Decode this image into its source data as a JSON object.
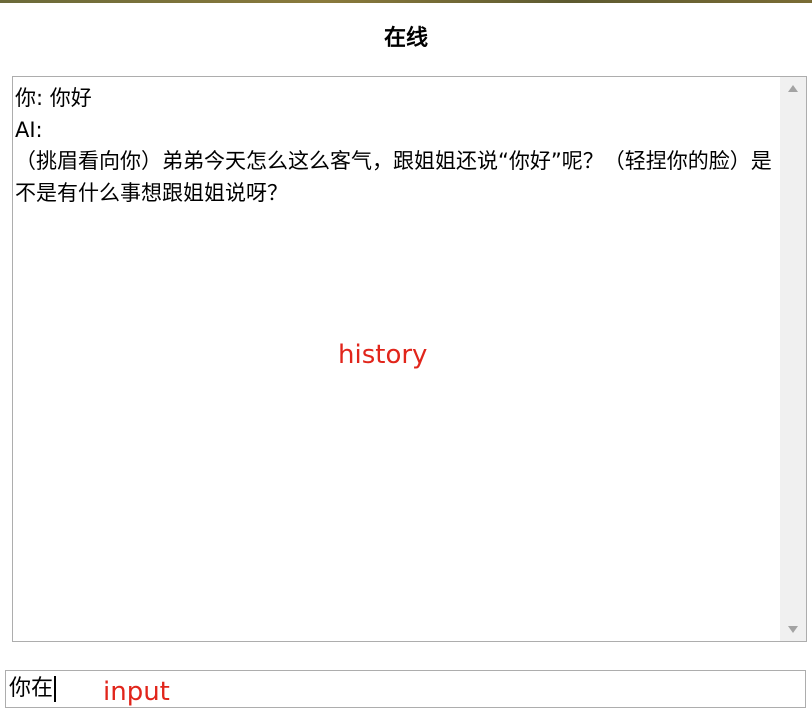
{
  "window": {
    "title": "在线"
  },
  "chat": {
    "history_text": "你: 你好\nAI:\n（挑眉看向你）弟弟今天怎么这么客气，跟姐姐还说“你好”呢？（轻捏你的脸）是不是有什么事想跟姐姐说呀？",
    "overlay_label": "history"
  },
  "input": {
    "value": "你在",
    "overlay_label": "input"
  },
  "colors": {
    "annotation": "#e1251b",
    "border": "#adadad",
    "scrollbar": "#f0f0f0"
  },
  "icons": {
    "scroll_up": "scroll-up-arrow-icon",
    "scroll_down": "scroll-down-arrow-icon"
  }
}
